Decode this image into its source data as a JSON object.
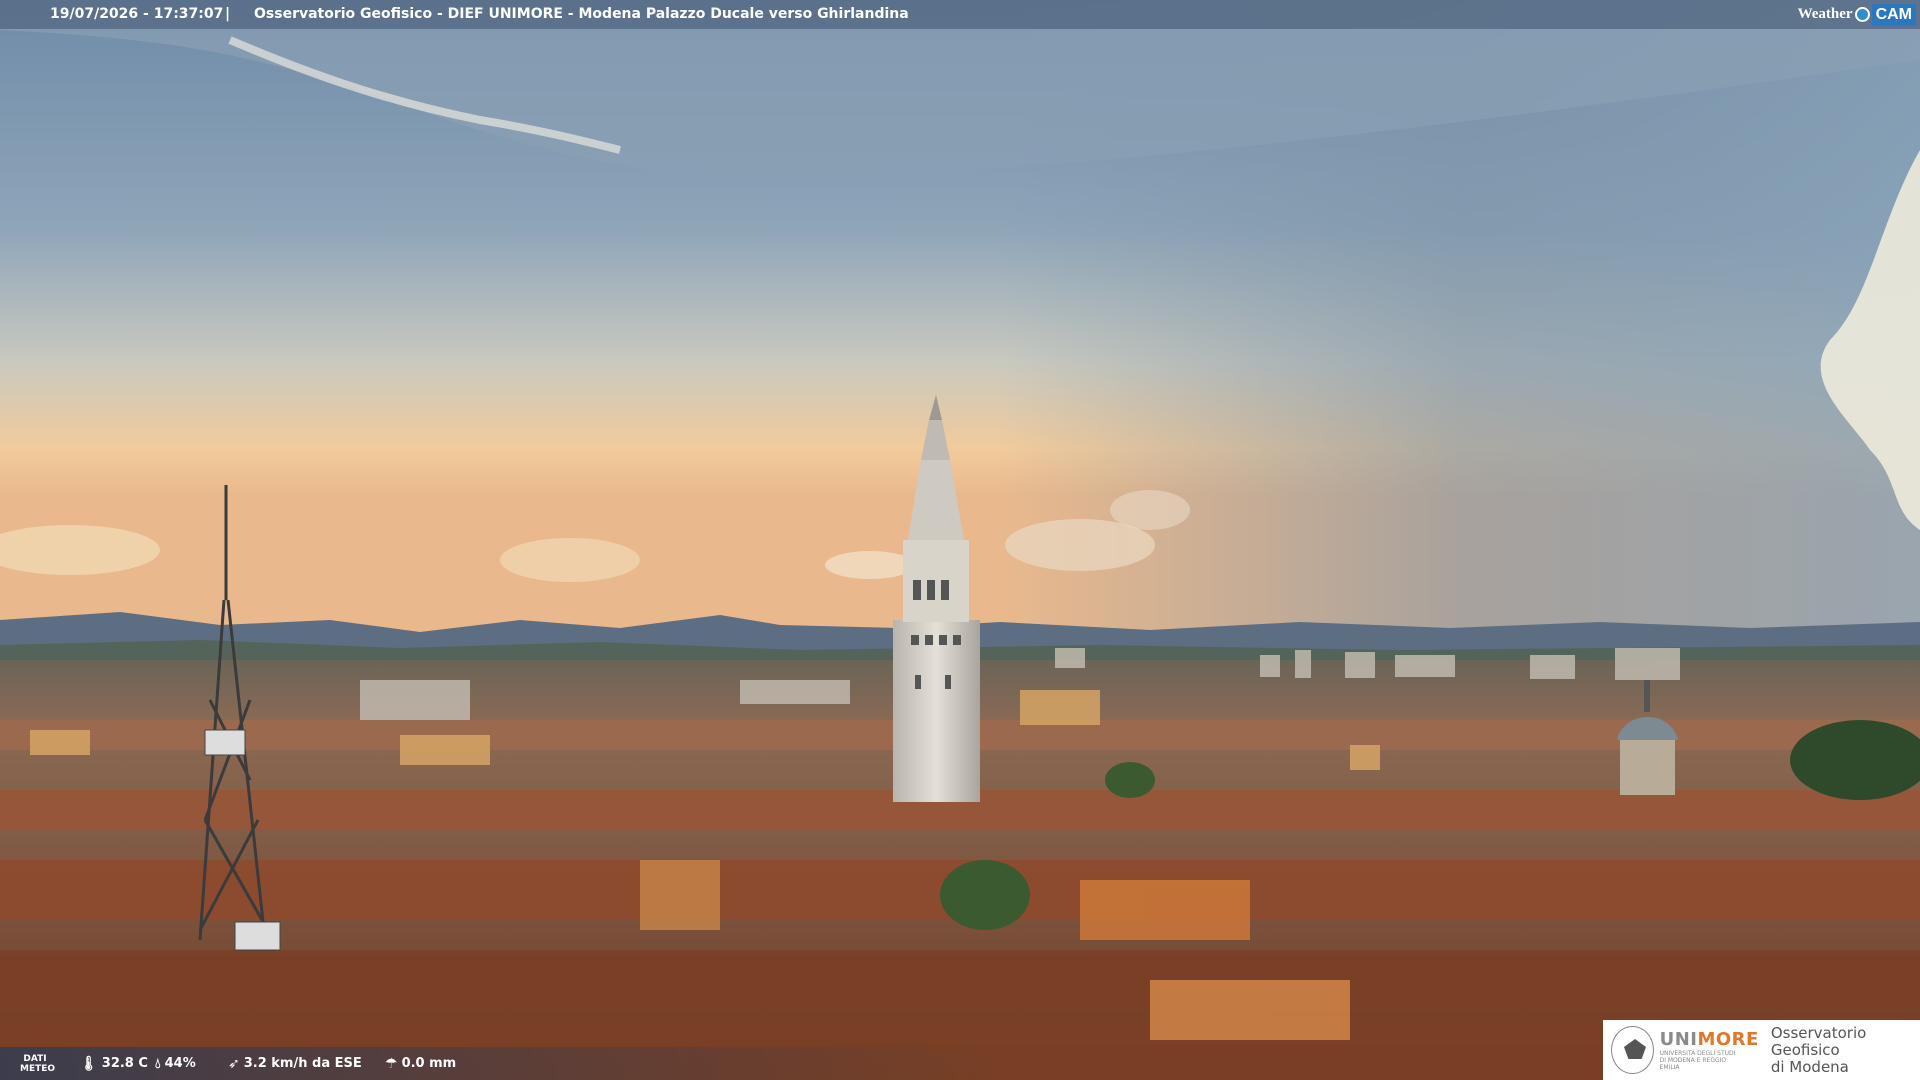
{
  "banner": {
    "datetime": "19/07/2026 - 17:37:07",
    "separator": "|",
    "title": "Osservatorio Geofisico - DIEF UNIMORE - Modena Palazzo Ducale verso Ghirlandina",
    "brand_weather": "Weather",
    "brand_cam": "CAM"
  },
  "weather": {
    "label_line1": "DATI",
    "label_line2": "METEO",
    "temperature": "32.8 C",
    "humidity": "44%",
    "wind": "3.2 km/h da ESE",
    "rain": "0.0 mm"
  },
  "logo": {
    "uni_part1": "UNI",
    "uni_part2": "MORE",
    "uni_sub": "UNIVERSITÀ DEGLI STUDI DI MODENA E REGGIO EMILIA",
    "obs_line1": "Osservatorio Geofisico",
    "obs_line2": "di Modena"
  },
  "colors": {
    "sky_top": "#6e8aa6",
    "sky_horizon": "#f0c89a",
    "roofs": "#9a5a3c",
    "tower": "#d8d4cc",
    "brand_orange": "#e0772a",
    "brand_blue": "#2c78c0"
  }
}
